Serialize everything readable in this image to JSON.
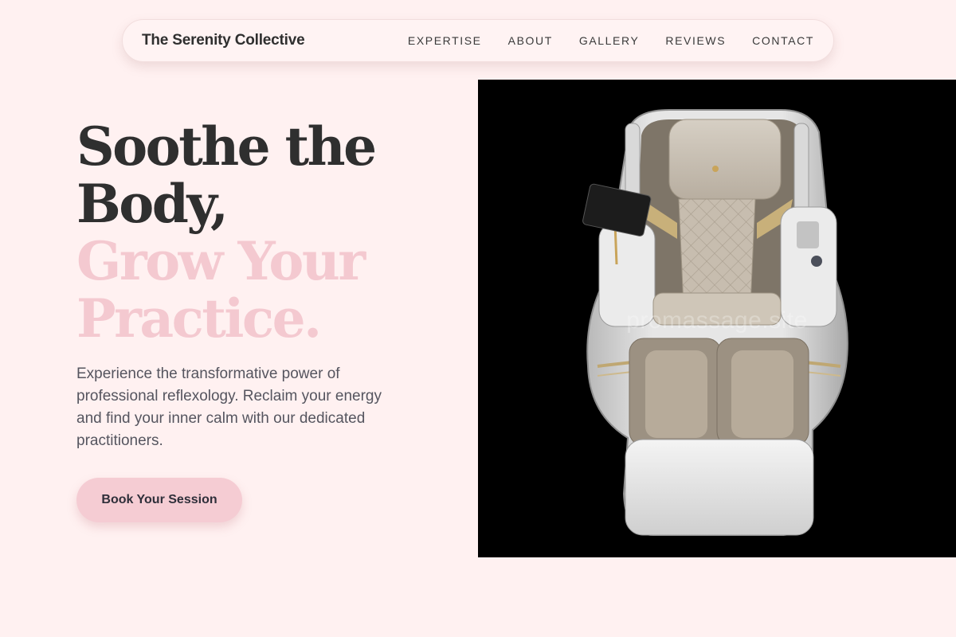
{
  "nav": {
    "brand": "The Serenity Collective",
    "links": [
      "EXPERTISE",
      "ABOUT",
      "GALLERY",
      "REVIEWS",
      "CONTACT"
    ]
  },
  "hero": {
    "title_line1": "Soothe the",
    "title_line2": "Body,",
    "title_line3": "Grow Your",
    "title_line4": "Practice.",
    "description": "Experience the transformative power of professional reflexology. Reclaim your energy and find your inner calm with our dedicated practitioners.",
    "cta_label": "Book Your Session"
  },
  "image": {
    "subject": "massage-chair",
    "watermark": "promassage.site"
  },
  "colors": {
    "background": "#fff1f1",
    "accent_pink": "#f4c9d0",
    "button_pink": "#f5ccd3",
    "text_dark": "#2f2f2f",
    "text_body": "#55555f"
  }
}
